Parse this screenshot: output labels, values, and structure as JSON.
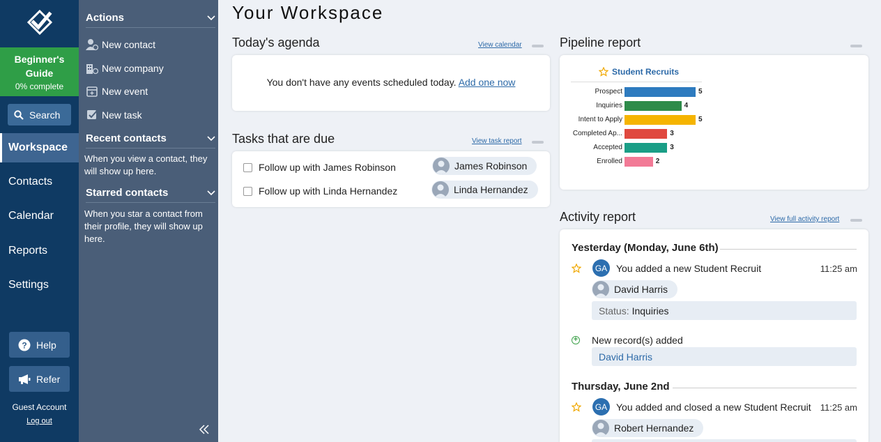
{
  "nav": {
    "guide_title": "Beginner's Guide",
    "guide_progress": "0% complete",
    "search_label": "Search",
    "items": [
      "Workspace",
      "Contacts",
      "Calendar",
      "Reports",
      "Settings"
    ],
    "active_item": "Workspace",
    "help_label": "Help",
    "refer_label": "Refer",
    "account_name": "Guest Account",
    "logout_label": "Log out"
  },
  "panel": {
    "actions_title": "Actions",
    "actions": [
      "New contact",
      "New company",
      "New event",
      "New task"
    ],
    "recent_title": "Recent contacts",
    "recent_text": "When you view a contact, they will show up here.",
    "starred_title": "Starred contacts",
    "starred_text": "When you star a contact from their profile, they will show up here."
  },
  "main": {
    "title": "Your Workspace",
    "agenda": {
      "title": "Today's agenda",
      "link": "View calendar",
      "message": "You don't have any events scheduled today.",
      "add_link": "Add one now"
    },
    "tasks": {
      "title": "Tasks that are due",
      "link": "View task report",
      "items": [
        {
          "label": "Follow up with James Robinson",
          "assignee": "James Robinson"
        },
        {
          "label": "Follow up with Linda Hernandez",
          "assignee": "Linda Hernandez"
        }
      ]
    },
    "pipeline": {
      "title": "Pipeline report",
      "chart_title": "Student Recruits"
    },
    "activity": {
      "title": "Activity report",
      "link": "View full activity report",
      "days": [
        {
          "heading": "Yesterday (Monday, June 6th)",
          "avatar": "GA",
          "text": "You added a new Student Recruit",
          "time": "11:25 am",
          "contact": "David Harris",
          "status_label": "Status:",
          "status_value": "Inquiries",
          "records_text": "New record(s) added",
          "records_name": "David Harris"
        },
        {
          "heading": "Thursday, June 2nd",
          "avatar": "GA",
          "text": "You added and closed a new Student Recruit",
          "time": "11:25 am",
          "contact": "Robert Hernandez"
        }
      ]
    }
  },
  "colors": {
    "nav_bg": "#0f3a63",
    "panel_bg": "#4a5e78",
    "guide_green": "#2f9e47",
    "link_blue": "#2d6aa8"
  },
  "chart_data": {
    "type": "bar",
    "orientation": "horizontal",
    "title": "Student Recruits",
    "categories": [
      "Prospect",
      "Inquiries",
      "Intent to Apply",
      "Completed Ap...",
      "Accepted",
      "Enrolled"
    ],
    "values": [
      5,
      4,
      5,
      3,
      3,
      2
    ],
    "colors": [
      "#2e7bbf",
      "#2e8b4a",
      "#f5b400",
      "#e0493f",
      "#1a9e86",
      "#f27a96"
    ],
    "xlim": [
      0,
      5
    ],
    "grid": false,
    "legend": "none"
  }
}
